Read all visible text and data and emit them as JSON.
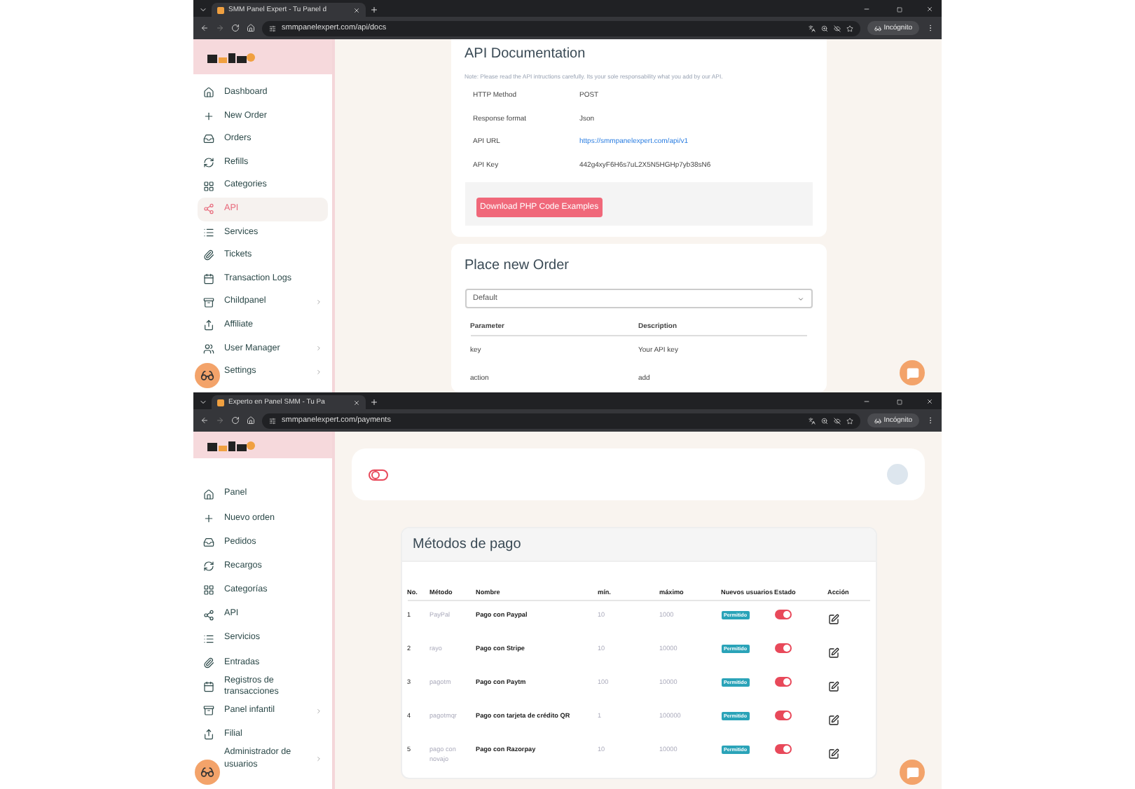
{
  "api_docs_screen": {
    "browser": {
      "tab_title": "SMM Panel Expert - Tu Panel d",
      "url": "smmpanelexpert.com/api/docs",
      "incognito_label": "Incógnito"
    },
    "sidebar": {
      "items": [
        {
          "label": "Dashboard",
          "selected": false,
          "submenu": false
        },
        {
          "label": "New Order",
          "selected": false,
          "submenu": false
        },
        {
          "label": "Orders",
          "selected": false,
          "submenu": false
        },
        {
          "label": "Refills",
          "selected": false,
          "submenu": false
        },
        {
          "label": "Categories",
          "selected": false,
          "submenu": false
        },
        {
          "label": "API",
          "selected": true,
          "submenu": false
        },
        {
          "label": "Services",
          "selected": false,
          "submenu": false
        },
        {
          "label": "Tickets",
          "selected": false,
          "submenu": false
        },
        {
          "label": "Transaction Logs",
          "selected": false,
          "submenu": false
        },
        {
          "label": "Childpanel",
          "selected": false,
          "submenu": true
        },
        {
          "label": "Affiliate",
          "selected": false,
          "submenu": false
        },
        {
          "label": "User Manager",
          "selected": false,
          "submenu": true
        },
        {
          "label": "Settings",
          "selected": false,
          "submenu": true
        }
      ]
    },
    "api_card": {
      "title": "API Documentation",
      "note": "Note: Please read the API intructions carefully. Its your sole responsability what you add by our API.",
      "rows": [
        {
          "label": "HTTP Method",
          "value": "POST",
          "kind": "text"
        },
        {
          "label": "Response format",
          "value": "Json",
          "kind": "text"
        },
        {
          "label": "API URL",
          "value": "https://smmpanelexpert.com/api/v1",
          "kind": "link"
        },
        {
          "label": "API Key",
          "value": "442g4xyF6H6s7uL2X5N5HGHp7yb38sN6",
          "kind": "text"
        }
      ],
      "button": "Download PHP Code Examples"
    },
    "order_card": {
      "title": "Place new Order",
      "select": "Default",
      "columns": [
        "Parameter",
        "Description"
      ],
      "rows": [
        [
          "key",
          "Your API key"
        ],
        [
          "action",
          "add"
        ]
      ]
    }
  },
  "payments_screen": {
    "browser": {
      "tab_title": "Experto en Panel SMM - Tu Pa",
      "url": "smmpanelexpert.com/payments",
      "incognito_label": "Incógnito"
    },
    "sidebar_toggle": {
      "on": false
    },
    "sidebar": {
      "items": [
        {
          "label": "Panel",
          "selected": false,
          "submenu": false
        },
        {
          "label": "Nuevo orden",
          "selected": false,
          "submenu": false
        },
        {
          "label": "Pedidos",
          "selected": false,
          "submenu": false
        },
        {
          "label": "Recargos",
          "selected": false,
          "submenu": false
        },
        {
          "label": "Categorías",
          "selected": false,
          "submenu": false
        },
        {
          "label": "API",
          "selected": false,
          "submenu": false
        },
        {
          "label": "Servicios",
          "selected": false,
          "submenu": false
        },
        {
          "label": "Entradas",
          "selected": false,
          "submenu": false
        },
        {
          "label": "Registros de transacciones",
          "selected": false,
          "submenu": false
        },
        {
          "label": "Panel infantil",
          "selected": false,
          "submenu": true
        },
        {
          "label": "Filial",
          "selected": false,
          "submenu": false
        },
        {
          "label": "Administrador de usuarios",
          "selected": false,
          "submenu": true
        }
      ]
    },
    "payments_card": {
      "title": "Métodos de pago",
      "columns": [
        "No.",
        "Método",
        "Nombre",
        "mín.",
        "máximo",
        "Nuevos usuarios",
        "Estado",
        "Acción"
      ],
      "rows": [
        {
          "no": "1",
          "method": "PayPal",
          "name": "Pago con Paypal",
          "min": "10",
          "max": "1000",
          "new_users": "Permitido",
          "on": true
        },
        {
          "no": "2",
          "method": "rayo",
          "name": "Pago con Stripe",
          "min": "10",
          "max": "10000",
          "new_users": "Permitido",
          "on": true
        },
        {
          "no": "3",
          "method": "pagotm",
          "name": "Pago con Paytm",
          "min": "100",
          "max": "10000",
          "new_users": "Permitido",
          "on": true
        },
        {
          "no": "4",
          "method": "pagotmqr",
          "name": "Pago con tarjeta de crédito QR",
          "min": "1",
          "max": "100000",
          "new_users": "Permitido",
          "on": true
        },
        {
          "no": "5",
          "method": "pago con novajo",
          "name": "Pago con Razorpay",
          "min": "10",
          "max": "10000",
          "new_users": "Permitido",
          "on": true
        }
      ]
    }
  }
}
